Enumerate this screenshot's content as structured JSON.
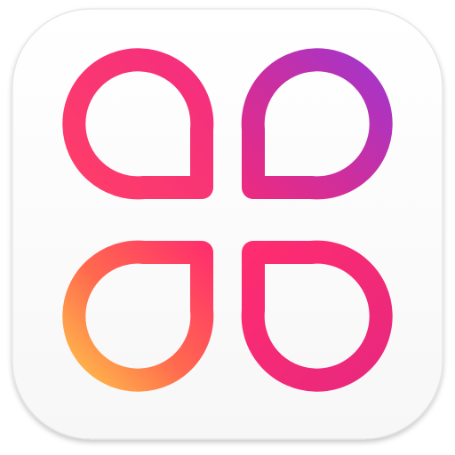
{
  "app_icon": {
    "name": "four-petal-logo",
    "background_color": "#FFFFFF",
    "tile_border_color": "#E4E4E4",
    "gradient_colors": {
      "yellow": "#FFC04A",
      "orange": "#FF6A4E",
      "pink": "#FF2D6E",
      "magenta": "#E3297F",
      "purple": "#A535C9"
    },
    "petals": [
      {
        "name": "petal-top-left",
        "icon": "teardrop-outline",
        "pointing": "bottom-right"
      },
      {
        "name": "petal-top-right",
        "icon": "teardrop-outline",
        "pointing": "bottom-left"
      },
      {
        "name": "petal-bottom-left",
        "icon": "teardrop-outline",
        "pointing": "top-right"
      },
      {
        "name": "petal-bottom-right",
        "icon": "teardrop-outline",
        "pointing": "top-left"
      }
    ]
  }
}
